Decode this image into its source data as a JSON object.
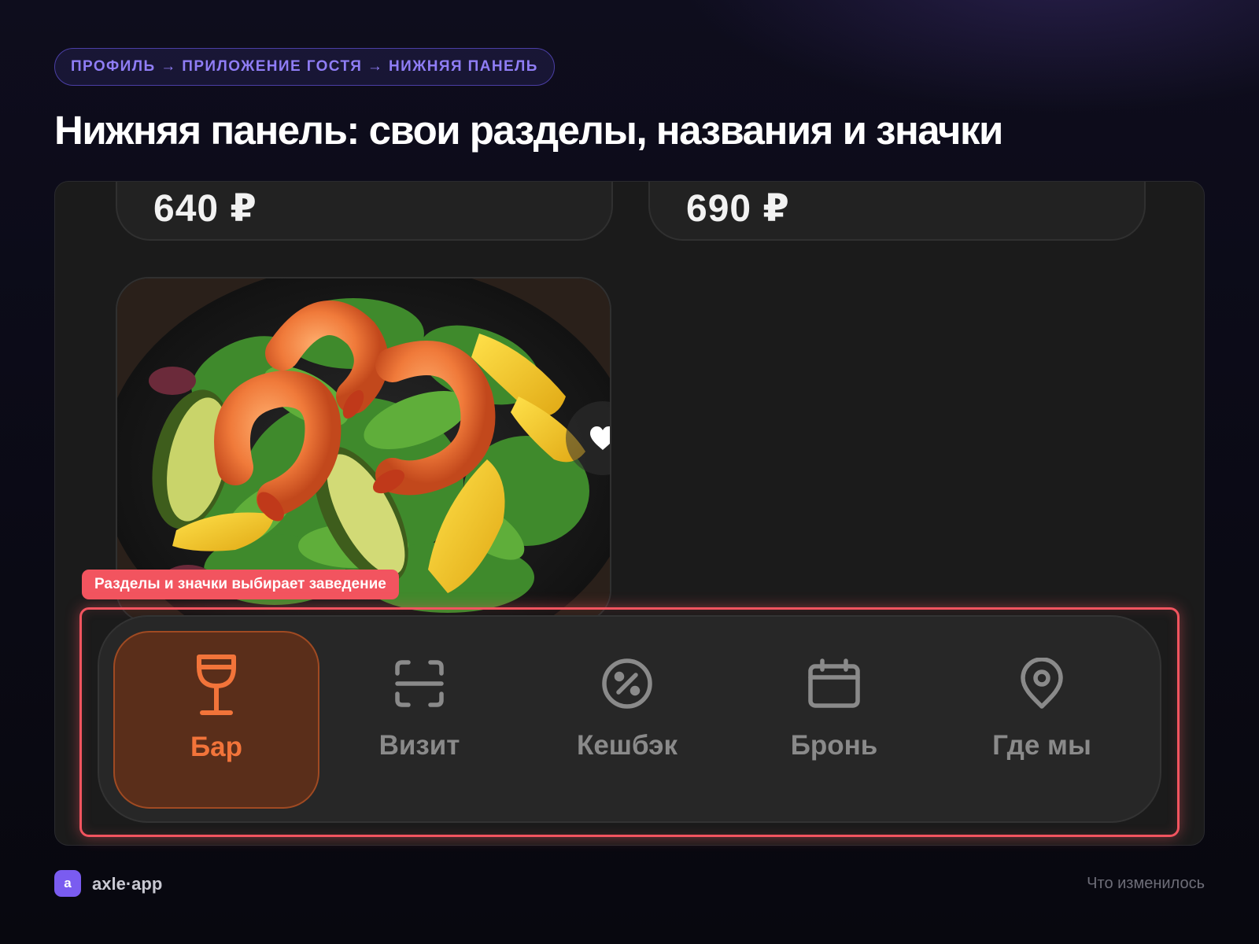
{
  "breadcrumb": "ПРОФИЛЬ → ПРИЛОЖЕНИЕ ГОСТЯ → НИЖНЯЯ ПАНЕЛЬ",
  "title": "Нижняя панель: свои разделы, названия и значки",
  "menu": {
    "top_cards": [
      {
        "price": "640 ₽"
      },
      {
        "price": "690 ₽"
      }
    ],
    "dish": {
      "image": "shrimp-avocado-mango-salad",
      "favorite_icon": "heart-icon"
    }
  },
  "callout": "Разделы и значки выбирает заведение",
  "tabbar": {
    "items": [
      {
        "label": "Бар",
        "icon": "wine-glass-icon",
        "active": true
      },
      {
        "label": "Визит",
        "icon": "scan-icon",
        "active": false
      },
      {
        "label": "Кешбэк",
        "icon": "percent-icon",
        "active": false
      },
      {
        "label": "Бронь",
        "icon": "calendar-icon",
        "active": false
      },
      {
        "label": "Где мы",
        "icon": "location-pin-icon",
        "active": false
      }
    ]
  },
  "colors": {
    "accent": "#f2743a",
    "highlight": "#f2545f",
    "brand": "#7a5cf0",
    "breadcrumb_text": "#8f7df5"
  },
  "footer": {
    "logo_letter": "a",
    "brand": "axle·app",
    "section": "Что изменилось"
  }
}
